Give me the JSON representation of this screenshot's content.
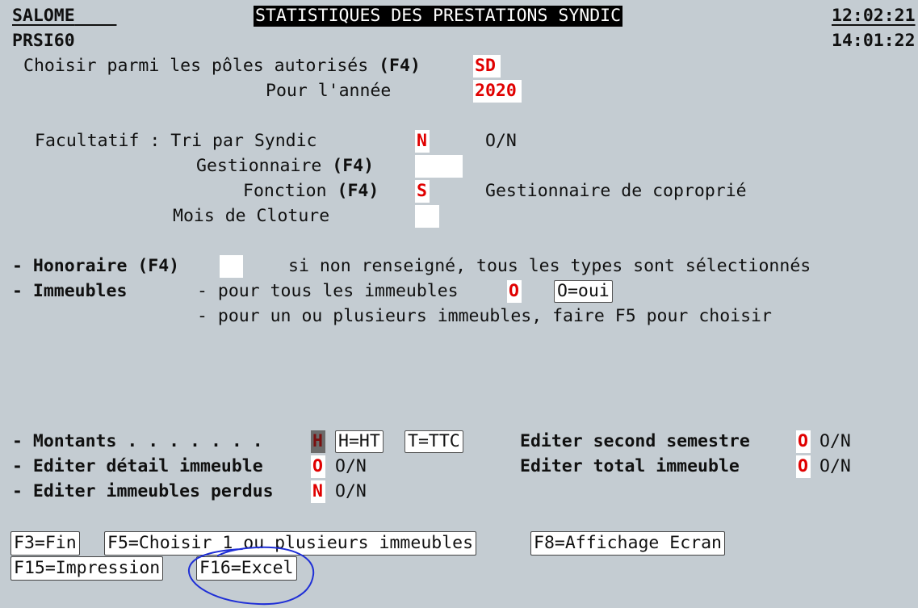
{
  "header": {
    "app": "SALOME",
    "title": "STATISTIQUES DES PRESTATIONS SYNDIC",
    "time": "12:02:21",
    "program": "PRSI60",
    "time2": "14:01:22"
  },
  "form": {
    "poles_label_a": "Choisir parmi les pôles autorisés",
    "poles_label_b": "(F4)",
    "poles_value": "SD",
    "annee_label": "Pour l'année",
    "annee_value": "2020",
    "tri_label": "Facultatif : Tri par Syndic",
    "tri_value": "N",
    "tri_hint": "O/N",
    "gest_label_a": "Gestionnaire",
    "gest_label_b": "(F4)",
    "gest_value": "",
    "fonction_label_a": "Fonction",
    "fonction_label_b": "(F4)",
    "fonction_value": "S",
    "fonction_desc": "Gestionnaire de coproprié",
    "mois_label": "Mois de Cloture",
    "mois_value": "",
    "honoraire_label_a": "- Honoraire",
    "honoraire_label_b": "(F4)",
    "honoraire_value": "",
    "honoraire_note": "si non renseigné, tous les types sont sélectionnés",
    "immeubles_label": "- Immeubles",
    "immeubles_line1": "- pour tous les immeubles",
    "immeubles_value": "O",
    "immeubles_btn": "O=oui",
    "immeubles_line2": "- pour un ou plusieurs immeubles, faire F5 pour choisir",
    "montants_label": "- Montants . . . . . . .",
    "montants_value": "H",
    "montants_ht": "H=HT",
    "montants_ttc": "T=TTC",
    "second_label": "Editer second semestre",
    "second_value": "O",
    "second_hint": "O/N",
    "detail_label": "- Editer détail immeuble",
    "detail_value": "O",
    "detail_hint": "O/N",
    "total_label": "Editer total immeuble",
    "total_value": "O",
    "total_hint": "O/N",
    "perdus_label": "- Editer immeubles perdus",
    "perdus_value": "N",
    "perdus_hint": "O/N"
  },
  "fkeys": {
    "f3": "F3=Fin",
    "f5": "F5=Choisir 1 ou plusieurs immeubles",
    "f8": "F8=Affichage Ecran",
    "f15": "F15=Impression",
    "f16": "F16=Excel"
  },
  "colors": {
    "background": "#c4ccd2",
    "field_text": "#e00000",
    "annotation": "#1f2fd6"
  }
}
